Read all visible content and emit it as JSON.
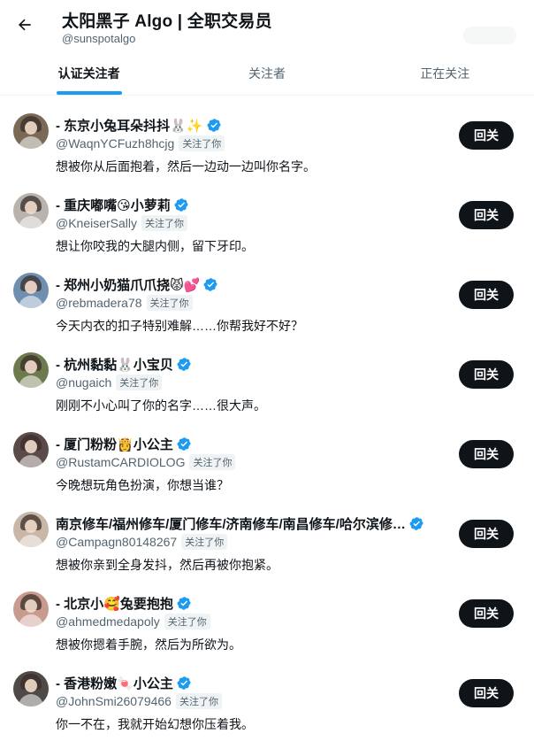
{
  "header": {
    "title": "太阳黑子 Algo | 全职交易员",
    "handle": "@sunspotalgo",
    "back_icon": "arrow-left-icon"
  },
  "tabs": [
    {
      "label": "认证关注者",
      "active": true
    },
    {
      "label": "关注者",
      "active": false
    },
    {
      "label": "正在关注",
      "active": false
    }
  ],
  "colors": {
    "accent": "#1d9bf0",
    "text": "#0f1419",
    "muted": "#536471",
    "button": "#0f1419"
  },
  "users": [
    {
      "name": "- 东京小兔耳朵抖抖🐰✨",
      "handle": "@WaqnYCFuzh8hcjg",
      "badge": "关注了你",
      "bio": "想被你从后面抱着，然后一边动一边叫你名字。",
      "button": "回关",
      "avatar_color": "#7a6a55"
    },
    {
      "name": "- 重庆嘟嘴😘小萝莉",
      "handle": "@KneiserSally",
      "badge": "关注了你",
      "bio": "想让你咬我的大腿内侧，留下牙印。",
      "button": "回关",
      "avatar_color": "#b8b3ad"
    },
    {
      "name": "- 郑州小奶猫爪爪挠😾💕",
      "handle": "@rebmadera78",
      "badge": "关注了你",
      "bio": "今天内衣的扣子特别难解……你帮我好不好？",
      "button": "回关",
      "avatar_color": "#6f8fb0"
    },
    {
      "name": "- 杭州黏黏🐰小宝贝",
      "handle": "@nugaich",
      "badge": "关注了你",
      "bio": "刚刚不小心叫了你的名字……很大声。",
      "button": "回关",
      "avatar_color": "#6d7a4e"
    },
    {
      "name": "- 厦门粉粉👸小公主",
      "handle": "@RustamCARDIOLOG",
      "badge": "关注了你",
      "bio": "今晚想玩角色扮演，你想当谁？",
      "button": "回关",
      "avatar_color": "#5a4a48"
    },
    {
      "name": "南京修车/福州修车/厦门修车/济南修车/南昌修车/哈尔滨修…",
      "handle": "@Campagn80148267",
      "badge": "关注了你",
      "bio": "想被你亲到全身发抖，然后再被你抱紧。",
      "button": "回关",
      "avatar_color": "#c8b7a6"
    },
    {
      "name": "- 北京小🥰兔要抱抱",
      "handle": "@ahmedmedapoly",
      "badge": "关注了你",
      "bio": "想被你摁着手腕，然后为所欲为。",
      "button": "回关",
      "avatar_color": "#c99a8e"
    },
    {
      "name": "- 香港粉嫩🍬小公主",
      "handle": "@JohnSmi26079466",
      "badge": "关注了你",
      "bio": "你一不在，我就开始幻想你压着我。",
      "button": "回关",
      "avatar_color": "#4f4a47"
    }
  ]
}
